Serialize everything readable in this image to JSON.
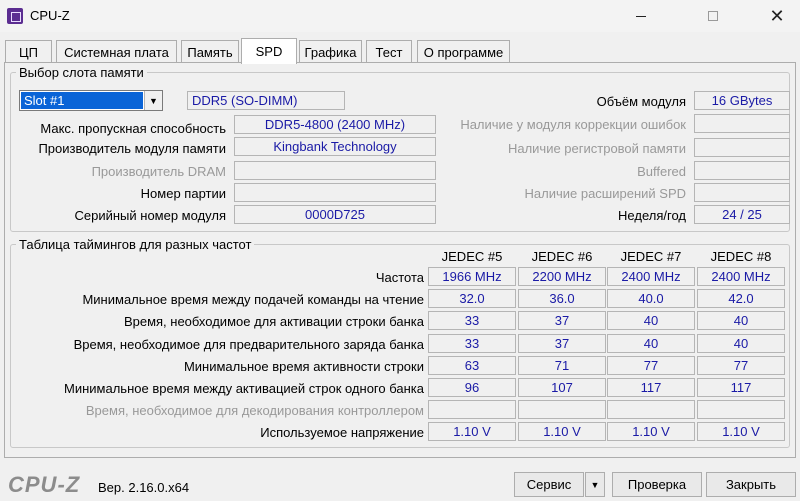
{
  "window": {
    "title": "CPU-Z",
    "icon": "cpu-z-icon"
  },
  "tabs": [
    {
      "label": "ЦП",
      "active": false
    },
    {
      "label": "Системная плата",
      "active": false
    },
    {
      "label": "Память",
      "active": false
    },
    {
      "label": "SPD",
      "active": true
    },
    {
      "label": "Графика",
      "active": false
    },
    {
      "label": "Тест",
      "active": false
    },
    {
      "label": "О программе",
      "active": false
    }
  ],
  "slot": {
    "legend": "Выбор слота памяти",
    "selected": "Slot #1",
    "type": "DDR5 (SO-DIMM)",
    "module_size_label": "Объём модуля",
    "module_size": "16 GBytes",
    "max_bandwidth_label": "Макс. пропускная способность",
    "max_bandwidth": "DDR5-4800 (2400 MHz)",
    "manufacturer_label": "Производитель модуля памяти",
    "manufacturer": "Kingbank Technology",
    "dram_manufacturer_label": "Производитель DRAM",
    "dram_manufacturer": "",
    "part_number_label": "Номер партии",
    "part_number": "",
    "serial_label": "Серийный номер модуля",
    "serial": "0000D725",
    "ecc_label": "Наличие у модуля коррекции ошибок",
    "ecc": "",
    "registered_label": "Наличие регистровой памяти",
    "registered": "",
    "buffered_label": "Buffered",
    "buffered": "",
    "spd_ext_label": "Наличие расширений SPD",
    "spd_ext": "",
    "week_year_label": "Неделя/год",
    "week_year": "24 / 25"
  },
  "timings": {
    "legend": "Таблица таймингов для разных частот",
    "columns": [
      "JEDEC #5",
      "JEDEC #6",
      "JEDEC #7",
      "JEDEC #8"
    ],
    "rows": [
      {
        "label": "Частота",
        "dim": false,
        "values": [
          "1966 MHz",
          "2200 MHz",
          "2400 MHz",
          "2400 MHz"
        ]
      },
      {
        "label": "Минимальное время между подачей команды на чтение",
        "dim": false,
        "values": [
          "32.0",
          "36.0",
          "40.0",
          "42.0"
        ]
      },
      {
        "label": "Время, необходимое для активации строки банка",
        "dim": false,
        "values": [
          "33",
          "37",
          "40",
          "40"
        ]
      },
      {
        "label": "Время, необходимое для предварительного заряда банка",
        "dim": false,
        "values": [
          "33",
          "37",
          "40",
          "40"
        ]
      },
      {
        "label": "Минимальное время активности строки",
        "dim": false,
        "values": [
          "63",
          "71",
          "77",
          "77"
        ]
      },
      {
        "label": "Минимальное время между активацией строк одного банка",
        "dim": false,
        "values": [
          "96",
          "107",
          "117",
          "117"
        ]
      },
      {
        "label": "Время, необходимое для декодирования контроллером",
        "dim": true,
        "values": [
          "",
          "",
          "",
          ""
        ]
      },
      {
        "label": "Используемое напряжение",
        "dim": false,
        "values": [
          "1.10 V",
          "1.10 V",
          "1.10 V",
          "1.10 V"
        ]
      }
    ]
  },
  "footer": {
    "logo": "CPU-Z",
    "version": "Вер. 2.16.0.x64",
    "tools_label": "Сервис",
    "validate_label": "Проверка",
    "close_label": "Закрыть"
  }
}
